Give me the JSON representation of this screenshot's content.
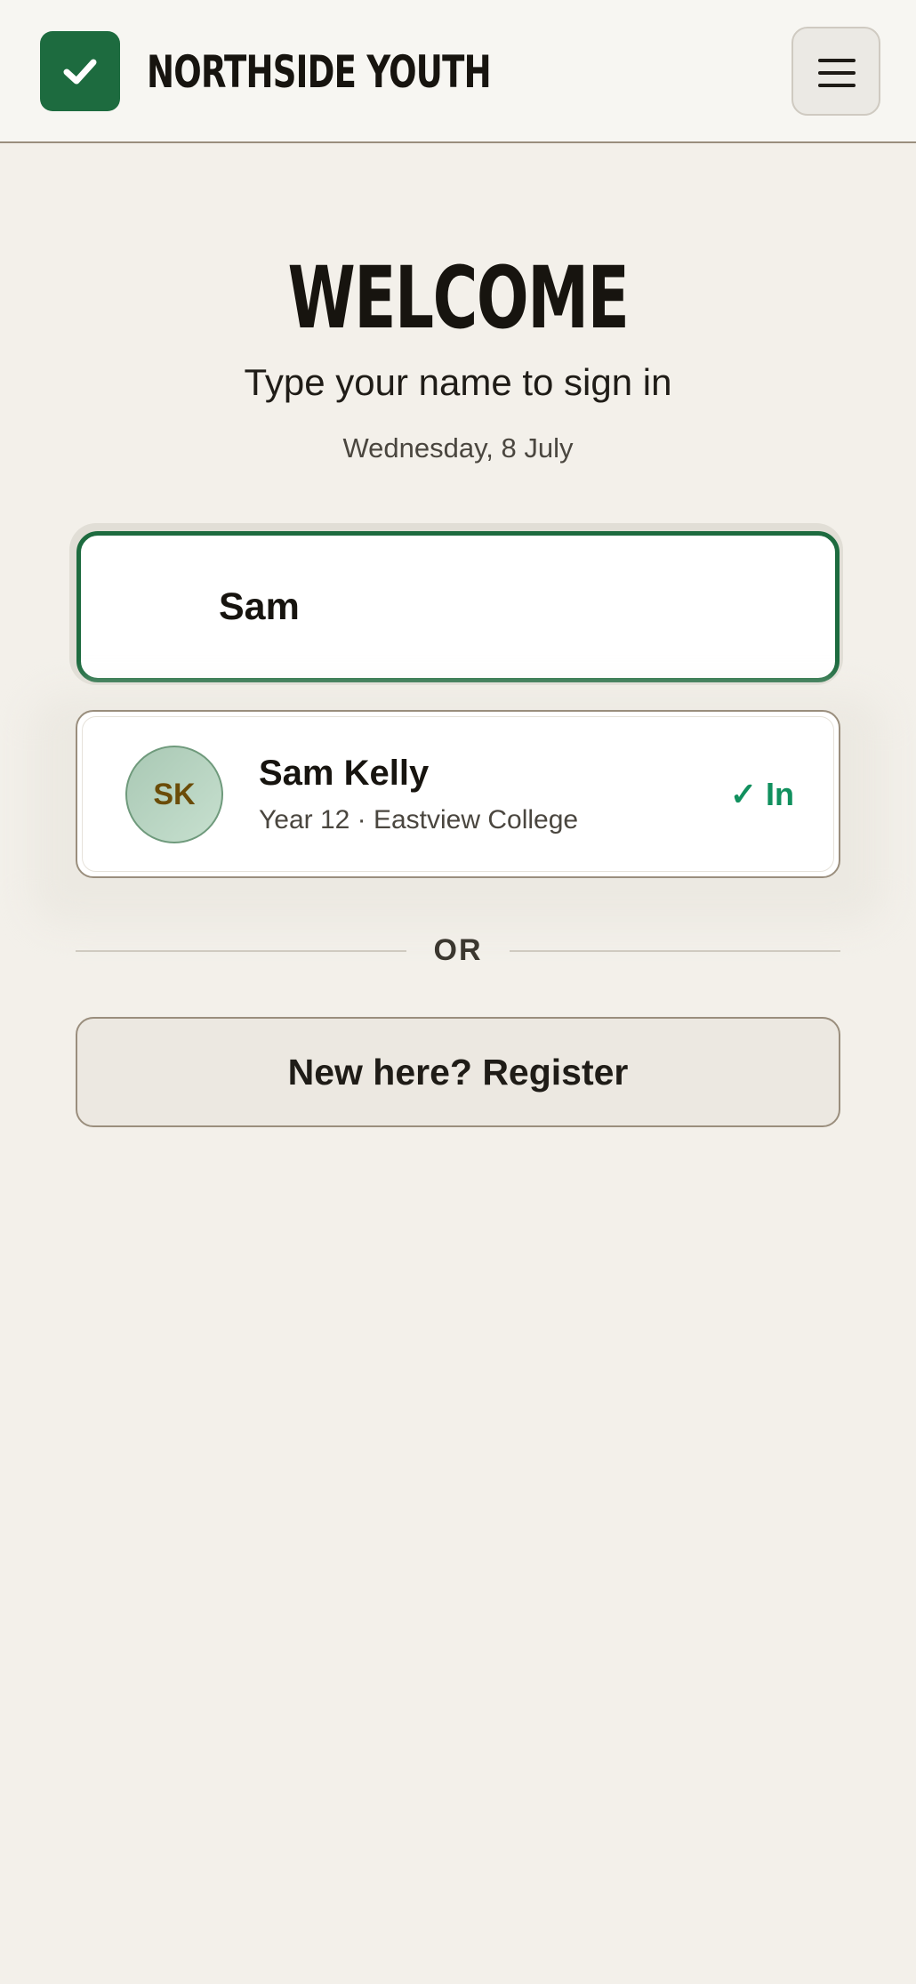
{
  "header": {
    "brand": "NORTHSIDE YOUTH",
    "logo_icon": "check-icon",
    "menu_icon": "hamburger-menu-icon",
    "brand_color": "#1d6b3f"
  },
  "main": {
    "title": "WELCOME",
    "subtitle": "Type your name to sign in",
    "date": "Wednesday, 8 July",
    "search": {
      "value": "Sam",
      "placeholder": ""
    },
    "results": [
      {
        "initials": "SK",
        "name": "Sam Kelly",
        "meta": "Year 12 · Eastview College",
        "status": "✓ In",
        "status_color": "#11905e"
      }
    ],
    "divider_text": "OR",
    "register_label": "New here? Register"
  }
}
